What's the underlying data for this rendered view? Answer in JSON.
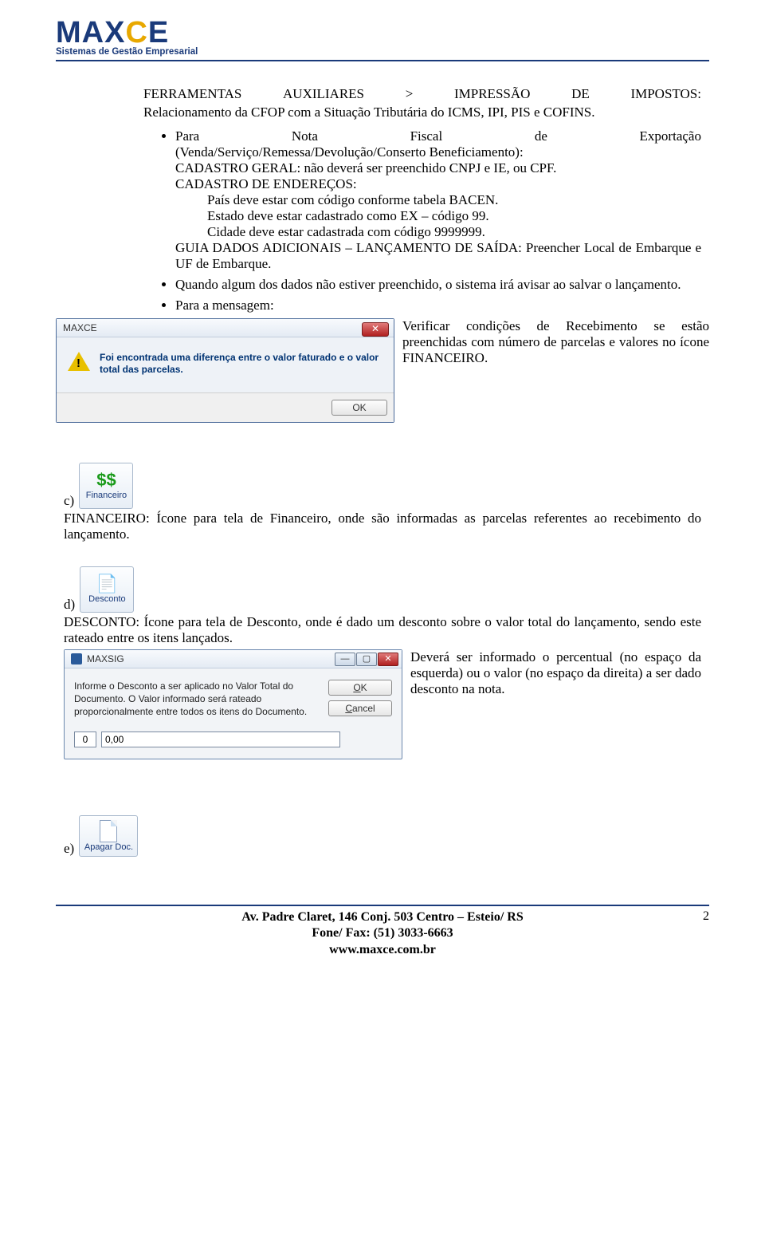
{
  "logo": {
    "text1": "M",
    "text2": "A",
    "text3": "X",
    "textC": "C",
    "textE": "E",
    "tagline": "Sistemas de Gestão Empresarial"
  },
  "intro": {
    "line1_words": [
      "FERRAMENTAS",
      "AUXILIARES",
      ">",
      "IMPRESSÃO",
      "DE",
      "IMPOSTOS:"
    ],
    "line2": "Relacionamento da CFOP com a Situação Tributária do ICMS, IPI, PIS e COFINS."
  },
  "bullets": {
    "b1_line1": [
      "Para",
      "Nota",
      "Fiscal",
      "de",
      "Exportação"
    ],
    "b1_line2": "(Venda/Serviço/Remessa/Devolução/Conserto Beneficiamento):",
    "b1_line3": "CADASTRO GERAL: não deverá ser preenchido CNPJ e IE, ou CPF.",
    "b1_line4": "CADASTRO DE ENDEREÇOS:",
    "b1_sub1": "País deve estar com código conforme tabela BACEN.",
    "b1_sub2": "Estado deve estar cadastrado como EX – código 99.",
    "b1_sub3": "Cidade deve estar cadastrada com código 9999999.",
    "b1_line5": "GUIA DADOS ADICIONAIS – LANÇAMENTO DE SAÍDA: Preencher Local de Embarque e UF de Embarque.",
    "b2": "Quando algum dos dados não estiver preenchido, o sistema irá avisar ao salvar o lançamento.",
    "b3": "Para a mensagem:"
  },
  "dialog1": {
    "title": "MAXCE",
    "message": "Foi encontrada uma diferença entre o valor faturado e o valor total das parcelas.",
    "ok": "OK"
  },
  "side1": "Verificar condições de Recebimento se estão preenchidas com número de parcelas e valores no ícone FINANCEIRO.",
  "sectionC": {
    "prefix": "c)",
    "btn_label": "Financeiro",
    "text": "FINANCEIRO: Ícone para tela de Financeiro, onde são informadas as parcelas referentes ao recebimento do lançamento."
  },
  "sectionD": {
    "prefix": "d)",
    "btn_label": "Desconto",
    "text": "DESCONTO: Ícone para tela de Desconto, onde é dado um desconto sobre o valor total do lançamento, sendo este rateado entre os itens lançados."
  },
  "dialog2": {
    "title": "MAXSIG",
    "message": "Informe o Desconto a ser aplicado no Valor Total do Documento. O Valor informado será rateado proporcionalmente entre todos os itens do Documento.",
    "ok": "OK",
    "cancel": "Cancel",
    "val1": "0",
    "val2": "0,00"
  },
  "side2": "Deverá ser informado o percentual (no espaço da esquerda) ou o valor (no espaço da direita) a ser dado desconto na nota.",
  "sectionE": {
    "prefix": "e)",
    "btn_label": "Apagar Doc."
  },
  "footer": {
    "addr": "Av. Padre Claret, 146 Conj. 503 Centro – Esteio/ RS",
    "phone": "Fone/ Fax: (51) 3033-6663",
    "site": "www.maxce.com.br",
    "page": "2"
  }
}
